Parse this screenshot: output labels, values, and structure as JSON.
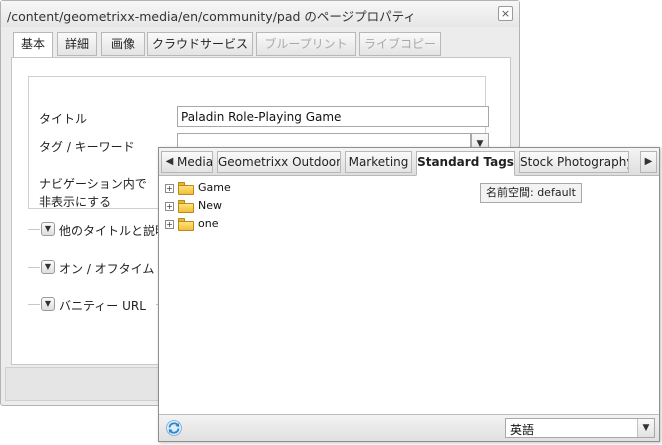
{
  "dialog": {
    "title": "/content/geometrixx-media/en/community/pad のページプロパティ",
    "close_icon": "×",
    "tabs": [
      {
        "label": "基本",
        "state": "active"
      },
      {
        "label": "詳細",
        "state": "normal"
      },
      {
        "label": "画像",
        "state": "normal"
      },
      {
        "label": "クラウドサービス",
        "state": "normal"
      },
      {
        "label": "ブループリント",
        "state": "disabled"
      },
      {
        "label": "ライブコピー",
        "state": "disabled"
      }
    ],
    "form": {
      "title_label": "タイトル",
      "title_value": "Paladin Role-Playing Game",
      "tags_label": "タグ / キーワード",
      "hide_nav_label_line1": "ナビゲーション内で",
      "hide_nav_label_line2": "非表示にする"
    },
    "sections": [
      {
        "label": "他のタイトルと説明"
      },
      {
        "label": "オン / オフタイム"
      },
      {
        "label": "バニティー URL"
      }
    ]
  },
  "tag_picker": {
    "scroll_left_icon": "◀",
    "scroll_right_icon": "▶",
    "tabs": [
      {
        "label": "Media",
        "state": "normal"
      },
      {
        "label": "Geometrixx Outdoors",
        "state": "normal"
      },
      {
        "label": "Marketing",
        "state": "normal"
      },
      {
        "label": "Standard Tags",
        "state": "active"
      },
      {
        "label": "Stock Photography",
        "state": "normal"
      }
    ],
    "tree": [
      {
        "label": "Game"
      },
      {
        "label": "New"
      },
      {
        "label": "one"
      }
    ],
    "expander_icon": "+",
    "tooltip": "名前空間: default",
    "language_value": "英語",
    "colors": {
      "folder": "#f0bf3b",
      "refresh": "#2f86c9"
    }
  }
}
